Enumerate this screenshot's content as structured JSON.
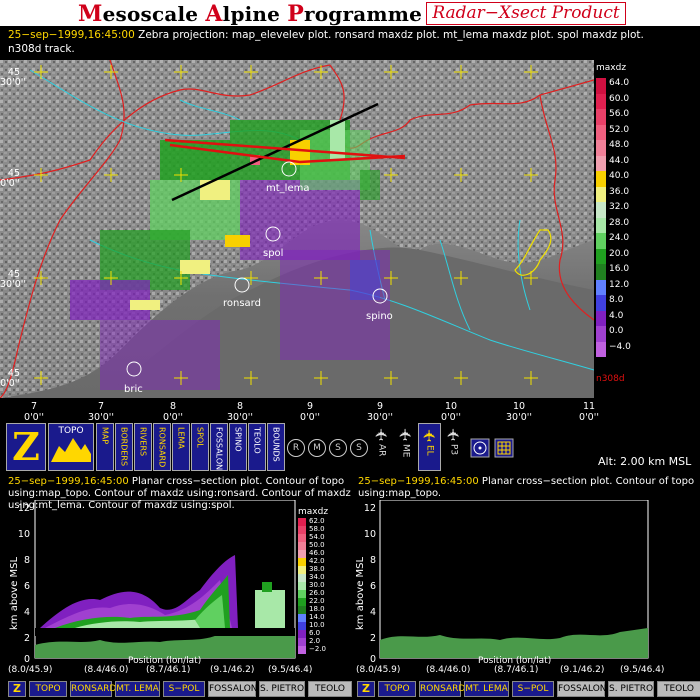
{
  "header": {
    "title_letters": [
      "M",
      "esoscale ",
      "A",
      "lpine ",
      "P",
      "rogramme"
    ],
    "subtitle": "Radar−Xsect Product"
  },
  "info": {
    "timestamp": "25−sep−1999,16:45:00",
    "line1": "Zebra projection: map_elevelev plot. ronsard maxdz plot. mt_lema maxdz plot. spol maxdz plot.",
    "line2": "n308d track."
  },
  "map": {
    "lat_labels": [
      {
        "deg": "45",
        "min": "30'0''"
      },
      {
        "deg": "45",
        "min": "0'0''"
      },
      {
        "deg": "45",
        "min": "30'0''"
      },
      {
        "deg": "45",
        "min": "0'0''"
      }
    ],
    "lon_labels": [
      {
        "deg": "7",
        "min": "0'0''"
      },
      {
        "deg": "7",
        "min": "30'0''"
      },
      {
        "deg": "8",
        "min": "0'0''"
      },
      {
        "deg": "8",
        "min": "30'0''"
      },
      {
        "deg": "9",
        "min": "0'0''"
      },
      {
        "deg": "9",
        "min": "30'0''"
      },
      {
        "deg": "10",
        "min": "0'0''"
      },
      {
        "deg": "10",
        "min": "30'0''"
      },
      {
        "deg": "11",
        "min": "0'0''"
      }
    ],
    "stations": [
      "mt_lema",
      "spol",
      "ronsard",
      "spino",
      "bric"
    ],
    "track_label": "n308d"
  },
  "colorbar": {
    "title": "maxdz",
    "values": [
      "64.0",
      "60.0",
      "56.0",
      "52.0",
      "48.0",
      "44.0",
      "40.0",
      "36.0",
      "32.0",
      "28.0",
      "24.0",
      "20.0",
      "16.0",
      "12.0",
      "8.0",
      "4.0",
      "0.0",
      "−4.0"
    ],
    "colors": [
      "#d01040",
      "#e02050",
      "#e84068",
      "#f06080",
      "#f08098",
      "#f0a0b0",
      "#f8d000",
      "#f0f080",
      "#c8e8c8",
      "#a8e8a8",
      "#60d060",
      "#20a020",
      "#208020",
      "#6080ff",
      "#4040e0",
      "#8020c0",
      "#a040d0",
      "#c060e0"
    ]
  },
  "toolbar": {
    "logo": "Z",
    "topo_label": "TOPO",
    "vertical_buttons": [
      "MAP",
      "BORDERS",
      "RIVERS",
      "RONSARD",
      "LEMA",
      "SPOL",
      "FOSSALON",
      "SPINO",
      "TEOLO",
      "BOUNDS"
    ],
    "round_buttons": [
      "R",
      "M",
      "S",
      "S"
    ],
    "plane_buttons": [
      "AR",
      "ME",
      "EL",
      "P3"
    ],
    "altitude": "Alt: 2.00 km MSL"
  },
  "plot_left": {
    "timestamp": "25−sep−1999,16:45:00",
    "desc": "Planar cross−section plot. Contour of topo using:map_topo. Contour of maxdz using:ronsard. Contour of maxdz using:mt_lema. Contour of maxdz using:spol.",
    "ylabel": "km above MSL",
    "xlabel": "Position (lon/lat)",
    "yticks": [
      "12",
      "10",
      "8",
      "6",
      "4",
      "2",
      "0"
    ],
    "xticks": [
      "(8.0/45.9)",
      "(8.4/46.0)",
      "(8.7/46.1)",
      "(9.1/46.2)",
      "(9.5/46.4)"
    ],
    "cb_title": "maxdz",
    "cb_values": [
      "62.0",
      "58.0",
      "54.0",
      "50.0",
      "46.0",
      "42.0",
      "38.0",
      "34.0",
      "30.0",
      "26.0",
      "22.0",
      "18.0",
      "14.0",
      "10.0",
      "6.0",
      "2.0",
      "−2.0"
    ]
  },
  "plot_right": {
    "timestamp": "25−sep−1999,16:45:00",
    "desc": "Planar cross−section plot. Contour of topo using:map_topo.",
    "ylabel": "km above MSL",
    "xlabel": "Position (lon/lat)",
    "yticks": [
      "12",
      "10",
      "8",
      "6",
      "4",
      "2",
      "0"
    ],
    "xticks": [
      "(8.0/45.9)",
      "(8.4/46.0)",
      "(8.7/46.1)",
      "(9.1/46.2)",
      "(9.5/46.4)"
    ]
  },
  "bottom_left": [
    "Z",
    "TOPO",
    "RONSARD",
    "MT. LEMA",
    "S−POL",
    "FOSSALON",
    "S. PIETRO",
    "TEOLO"
  ],
  "bottom_right": [
    "Z",
    "TOPO",
    "RONSARD",
    "MT. LEMA",
    "S−POL",
    "FOSSALON",
    "S. PIETRO",
    "TEOLO"
  ]
}
